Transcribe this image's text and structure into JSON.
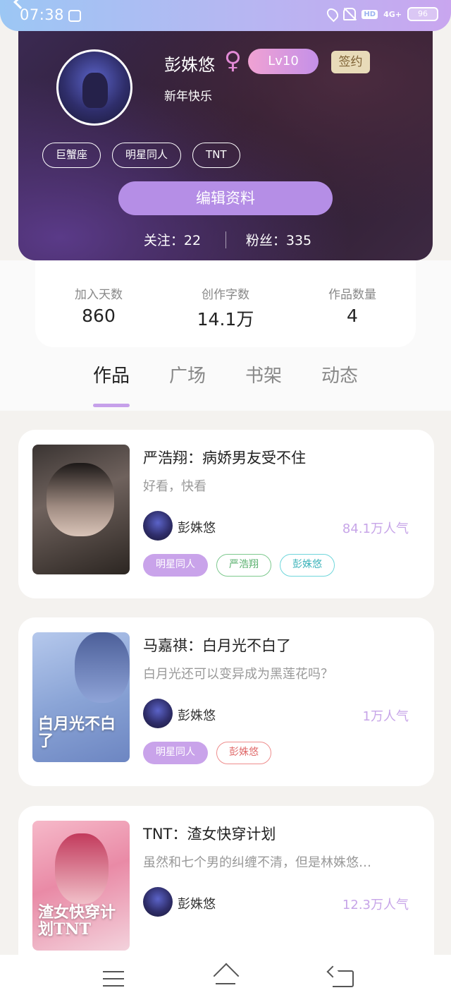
{
  "status": {
    "time": "07:38",
    "network": "4G+",
    "battery": "96",
    "hd_label": "HD"
  },
  "profile": {
    "name": "彭姝悠",
    "gender_symbol": "♀",
    "level": "Lv10",
    "sign_label": "签约",
    "motto": "新年快乐",
    "tags": [
      "巨蟹座",
      "明星同人",
      "TNT"
    ],
    "edit_label": "编辑资料",
    "following": "关注：22",
    "followers": "粉丝：335"
  },
  "stats": [
    {
      "label": "加入天数",
      "value": "860"
    },
    {
      "label": "创作字数",
      "value": "14.1万"
    },
    {
      "label": "作品数量",
      "value": "4"
    }
  ],
  "tabs": [
    "作品",
    "广场",
    "书架",
    "动态"
  ],
  "active_tab": "作品",
  "works": [
    {
      "title": "严浩翔：病娇男友受不住",
      "desc": "好看，快看",
      "author": "彭姝悠",
      "popularity": "84.1万人气",
      "tags": [
        {
          "label": "明星同人",
          "style": "purple"
        },
        {
          "label": "严浩翔",
          "style": "green"
        },
        {
          "label": "彭姝悠",
          "style": "teal"
        }
      ]
    },
    {
      "title": "马嘉祺：白月光不白了",
      "desc": "白月光还可以变异成为黑莲花吗？",
      "author": "彭姝悠",
      "popularity": "1万人气",
      "cover_text": "白月光不白了",
      "tags": [
        {
          "label": "明星同人",
          "style": "purple"
        },
        {
          "label": "彭姝悠",
          "style": "red"
        }
      ]
    },
    {
      "title": "TNT：渣女快穿计划",
      "desc": "虽然和七个男的纠缠不清，但是林姝悠…",
      "author": "彭姝悠",
      "popularity": "12.3万人气",
      "cover_text": "渣女快穿计划TNT",
      "tags": []
    }
  ],
  "colors": {
    "accent_purple": "#b58ee6",
    "popularity": "#c7a5e8"
  }
}
